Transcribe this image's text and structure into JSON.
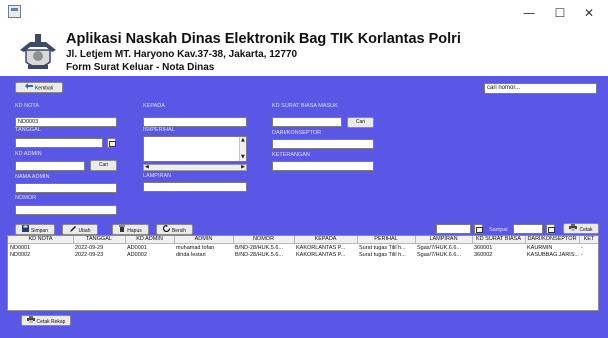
{
  "window": {
    "minimize": "—",
    "maximize": "☐",
    "close": "✕"
  },
  "header": {
    "title": "Aplikasi Naskah Dinas Elektronik Bag TIK Korlantas Polri",
    "address": "Jl. Letjem MT. Haryono Kav.37-38, Jakarta, 12770",
    "subtitle": "Form Surat Keluar - Nota Dinas"
  },
  "toolbar": {
    "back_label": "Kembali",
    "search_value": "cari nomor..."
  },
  "form": {
    "kd_nota": {
      "label": "KD NOTA",
      "value": "ND0003"
    },
    "tanggal": {
      "label": "TANGGAL",
      "value": ""
    },
    "kd_admin": {
      "label": "KD ADMIN",
      "value": "",
      "button": "Cari"
    },
    "nama_admin": {
      "label": "NAMA ADMIN",
      "value": ""
    },
    "nomor": {
      "label": "NOMOR",
      "value": ""
    },
    "kepada": {
      "label": "KEPADA",
      "value": ""
    },
    "perihal": {
      "label": "ISI/PERIHAL",
      "value": ""
    },
    "lampiran": {
      "label": "LAMPIRAN",
      "value": ""
    },
    "kd_surat": {
      "label": "KD SURAT BIASA MASUK",
      "value": "",
      "button": "Cari"
    },
    "dari": {
      "label": "DARI/KONSEPTOR",
      "value": ""
    },
    "keterangan": {
      "label": "KETERANGAN",
      "value": ""
    }
  },
  "actions": {
    "simpan": "Simpan",
    "ubah": "Ubah",
    "hapus": "Hapus",
    "bersih": "Bersih",
    "sampai": "Sampai",
    "cetak": "Cetak",
    "cetak_rekap": "Cetak Rekap"
  },
  "table": {
    "headers": [
      "KD NOTA",
      "TANGGAL",
      "KD ADMIN",
      "ADMIN",
      "NOMOR",
      "KEPADA",
      "PERIHAL",
      "LAMPIRAN",
      "KD SURAT BIASA",
      "DARI/KONSEPTOR",
      "KET"
    ],
    "rows": [
      [
        "ND0001",
        "2022-09-29",
        "AD0001",
        "muhamad tofan",
        "B/ND-28/HUK.5.6...",
        "KAKORLANTAS P...",
        "Surat tugas Tilil h...",
        "Sgas/7/HUK.6.6...",
        "360001",
        "KAURMIN",
        "-"
      ],
      [
        "ND0002",
        "2022-09-23",
        "AD0002",
        "dinda lestari",
        "B/ND-28/HUK.5.6...",
        "KAKORLANTAS P...",
        "Surat tugas Tilil h...",
        "Sgas/7/HUK.6.6...",
        "360002",
        "KASUBBAG.JARIS...",
        "-"
      ]
    ]
  },
  "colors": {
    "background": "#5b57e6",
    "label": "#dfe0ff"
  }
}
